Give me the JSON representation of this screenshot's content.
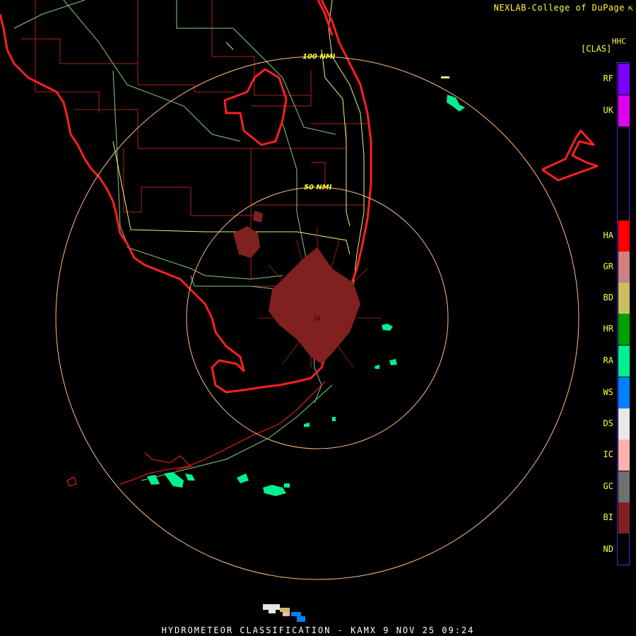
{
  "header": {
    "credit": "NEXLAB-College of DuPage",
    "credit_mark": "⇱"
  },
  "product": {
    "code": "HHC",
    "bracket_label": "[CLAS]"
  },
  "range_rings": [
    {
      "label": "100 NMI"
    },
    {
      "label": "50 NMI"
    }
  ],
  "legend": [
    {
      "code": "RF",
      "color": "#7a00ff"
    },
    {
      "code": "UK",
      "color": "#e000f0"
    },
    {
      "code": "HA",
      "color": "#ff0000"
    },
    {
      "code": "GR",
      "color": "#d08080"
    },
    {
      "code": "BD",
      "color": "#c8c060"
    },
    {
      "code": "HR",
      "color": "#00a000"
    },
    {
      "code": "RA",
      "color": "#00f090"
    },
    {
      "code": "WS",
      "color": "#0080ff"
    },
    {
      "code": "DS",
      "color": "#e8e8e8"
    },
    {
      "code": "IC",
      "color": "#ffb0b0"
    },
    {
      "code": "GC",
      "color": "#707070"
    },
    {
      "code": "BI",
      "color": "#802020"
    },
    {
      "code": "ND",
      "color": "#000000"
    }
  ],
  "colors": {
    "coastline": "#ff2020",
    "county_lines": "#b02020",
    "highways": "#f0f080",
    "roads": "#80d080",
    "range_ring": "#ffc080",
    "biological_echo": "#802020",
    "rain_echo": "#00f090"
  },
  "footer": {
    "title": "HYDROMETEOR CLASSIFICATION - KAMX 9 NOV 25 09:24"
  }
}
